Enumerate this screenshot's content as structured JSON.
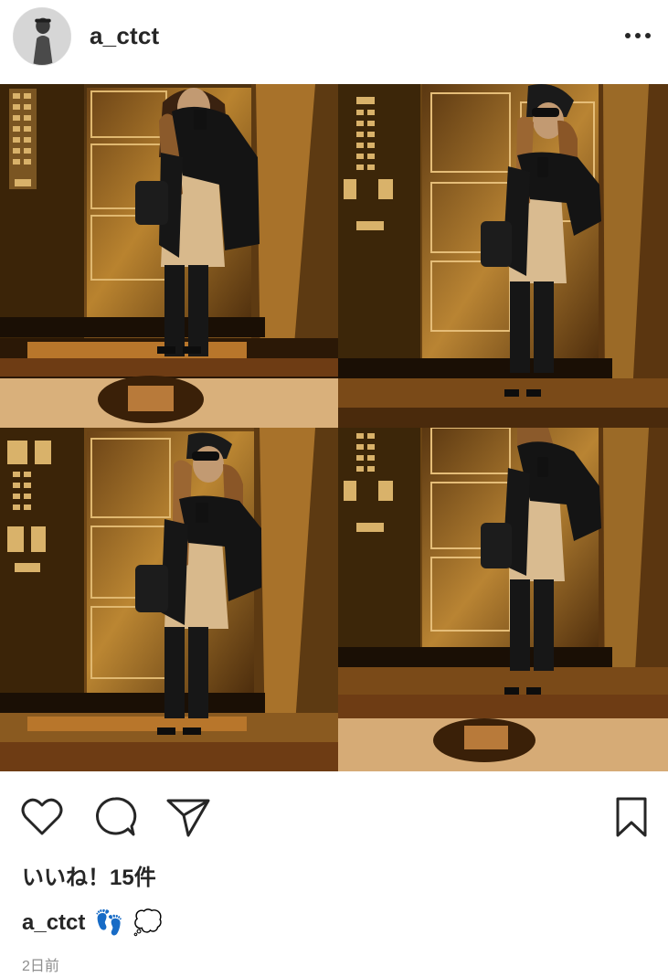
{
  "header": {
    "username": "a_ctct",
    "avatar_icon": "profile-photo",
    "more_icon": "more-horizontal-icon"
  },
  "post": {
    "image_icon": "elevator-mirror-selfie-collage",
    "collage_tiles": 4
  },
  "actions": {
    "like_icon": "heart-icon",
    "comment_icon": "comment-bubble-icon",
    "share_icon": "paper-plane-icon",
    "save_icon": "bookmark-icon"
  },
  "likes": "いいね！15件",
  "caption": {
    "username": "a_ctct",
    "emoji_1": "👣",
    "emoji_2": "💭"
  },
  "timestamp": "2日前",
  "colors": {
    "text": "#262626",
    "muted": "#8e8e8e",
    "elevator_gold": "#b07a2e",
    "elevator_dark": "#3a220c"
  }
}
